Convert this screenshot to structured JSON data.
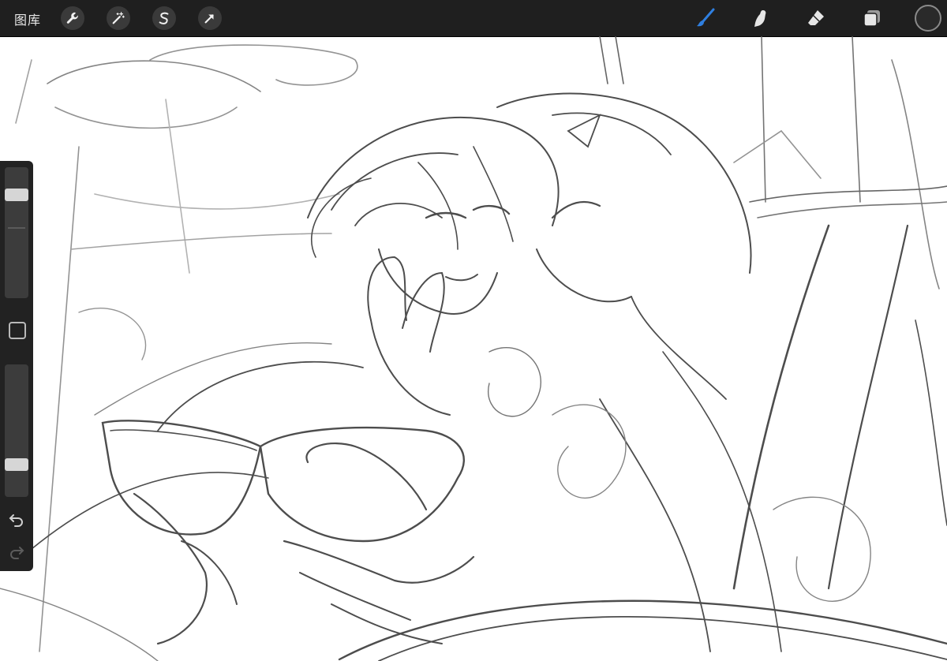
{
  "topbar": {
    "gallery_label": "图库",
    "left_tools": [
      {
        "name": "actions",
        "icon": "wrench-icon"
      },
      {
        "name": "adjustments",
        "icon": "magic-wand-icon"
      },
      {
        "name": "selection",
        "icon": "selection-s-icon"
      },
      {
        "name": "transform",
        "icon": "arrow-cursor-icon"
      }
    ],
    "right_tools": [
      {
        "name": "brush",
        "icon": "brush-icon",
        "active": true
      },
      {
        "name": "smudge",
        "icon": "smudge-icon"
      },
      {
        "name": "eraser",
        "icon": "eraser-icon"
      },
      {
        "name": "layers",
        "icon": "layers-icon"
      }
    ],
    "accent_color": "#2f7fe0",
    "current_color": "#2a2a2a"
  },
  "sidebar": {
    "brush_size_level": 0.82,
    "opacity_level": 0.22,
    "modify_icon": "square-icon",
    "undo_icon": "undo-icon",
    "redo_icon": "redo-icon"
  },
  "canvas": {
    "subject": "pencil-sketch",
    "background": "#ffffff",
    "stroke_color": "#3a3a3a"
  }
}
